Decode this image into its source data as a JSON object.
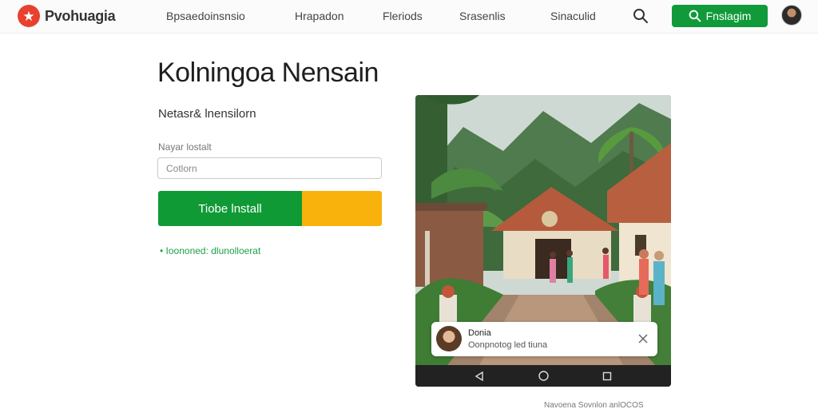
{
  "header": {
    "brand": "Pvohuagia",
    "logo_icon": "star-logo-icon",
    "nav": [
      "Bpsaedoinsnsio",
      "Hrapadon",
      "Fleriods",
      "Srasenlis",
      "Sinaculid"
    ],
    "search_icon": "search-icon",
    "cta_label": "Fnslagim",
    "cta_icon": "search-icon",
    "avatar_icon": "user-avatar"
  },
  "main": {
    "title": "Kolningoa Nensain",
    "subtitle": "Netasr& lnensilorn",
    "field_label": "Nayar lostalt",
    "field_placeholder": "Cotlorn",
    "install_label": "Tiobe lnstall",
    "link_text": "• Ioononed: dlunolloerat"
  },
  "phone": {
    "notification": {
      "name": "Donia",
      "text": "Oonpnotog led tiuna"
    },
    "nav_buttons": [
      "back-icon",
      "home-icon",
      "recents-icon"
    ]
  },
  "footer": {
    "text": "Navoena Sovnlon anlOCOS"
  },
  "colors": {
    "brand_red": "#e8412f",
    "primary_green": "#109a3a",
    "accent_yellow": "#f9b20b",
    "link_green": "#20a04a"
  }
}
